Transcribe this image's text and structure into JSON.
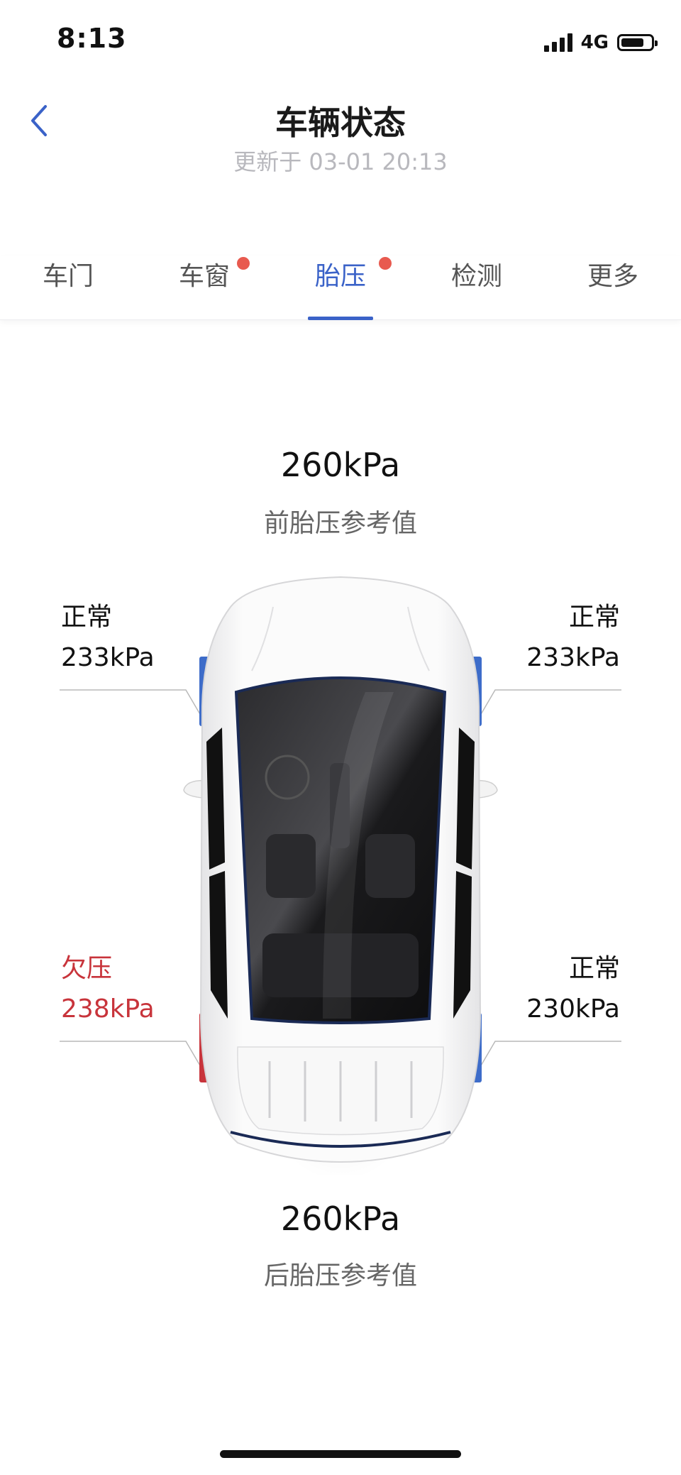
{
  "status_bar": {
    "time": "8:13",
    "network": "4G"
  },
  "header": {
    "title": "车辆状态",
    "updated": "更新于 03-01 20:13"
  },
  "tabs": [
    {
      "label": "车门",
      "active": false,
      "badge": false
    },
    {
      "label": "车窗",
      "active": false,
      "badge": true
    },
    {
      "label": "胎压",
      "active": true,
      "badge": true
    },
    {
      "label": "检测",
      "active": false,
      "badge": false
    },
    {
      "label": "更多",
      "active": false,
      "badge": false
    }
  ],
  "front_reference": {
    "value": "260kPa",
    "label": "前胎压参考值"
  },
  "rear_reference": {
    "value": "260kPa",
    "label": "后胎压参考值"
  },
  "tires": {
    "front_left": {
      "status": "正常",
      "pressure": "233kPa",
      "warning": false
    },
    "front_right": {
      "status": "正常",
      "pressure": "233kPa",
      "warning": false
    },
    "rear_left": {
      "status": "欠压",
      "pressure": "238kPa",
      "warning": true
    },
    "rear_right": {
      "status": "正常",
      "pressure": "230kPa",
      "warning": false
    }
  },
  "colors": {
    "accent": "#3a62c8",
    "warning": "#c8343b",
    "badge": "#e85a4f",
    "normal_tire": "#3d6cc9"
  }
}
